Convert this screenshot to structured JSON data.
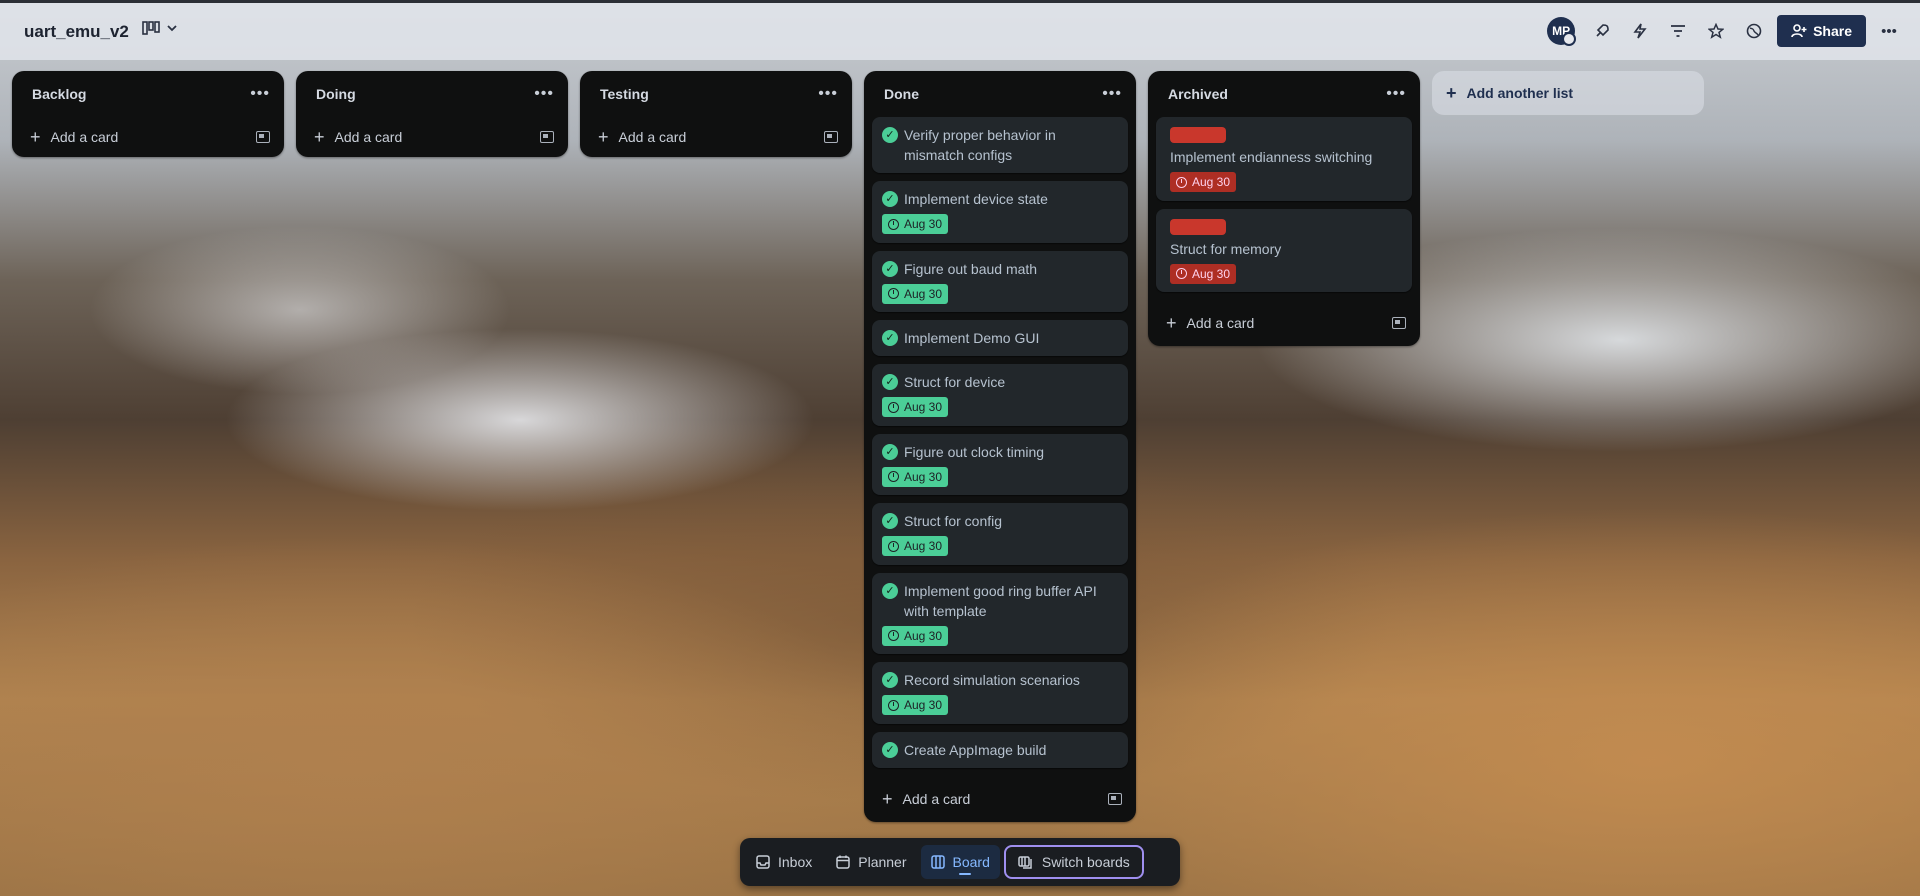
{
  "header": {
    "board_title": "uart_emu_v2",
    "avatar_initials": "MP",
    "share_label": "Share"
  },
  "lists": [
    {
      "title": "Backlog",
      "add_card_label": "Add a card"
    },
    {
      "title": "Doing",
      "add_card_label": "Add a card"
    },
    {
      "title": "Testing",
      "add_card_label": "Add a card"
    },
    {
      "title": "Done",
      "add_card_label": "Add a card",
      "cards": [
        {
          "title": "Verify proper behavior in mismatch configs",
          "due": ""
        },
        {
          "title": "Implement device state",
          "due": "Aug 30"
        },
        {
          "title": "Figure out baud math",
          "due": "Aug 30"
        },
        {
          "title": "Implement Demo GUI",
          "due": ""
        },
        {
          "title": "Struct for device",
          "due": "Aug 30"
        },
        {
          "title": "Figure out clock timing",
          "due": "Aug 30"
        },
        {
          "title": "Struct for config",
          "due": "Aug 30"
        },
        {
          "title": "Implement good ring buffer API with template",
          "due": "Aug 30"
        },
        {
          "title": "Record simulation scenarios",
          "due": "Aug 30"
        },
        {
          "title": "Create AppImage build",
          "due": ""
        }
      ]
    },
    {
      "title": "Archived",
      "add_card_label": "Add a card",
      "cards": [
        {
          "title": "Implement endianness switching",
          "due": "Aug 30",
          "label_color": "#c9372c"
        },
        {
          "title": "Struct for memory",
          "due": "Aug 30",
          "label_color": "#c9372c"
        }
      ]
    }
  ],
  "add_list_label": "Add another list",
  "bottom_nav": {
    "inbox": "Inbox",
    "planner": "Planner",
    "board": "Board",
    "switch_boards": "Switch boards"
  },
  "colors": {
    "complete_badge": "#4bce97",
    "overdue_badge": "#ae2e24",
    "accent": "#1f2f4f"
  }
}
